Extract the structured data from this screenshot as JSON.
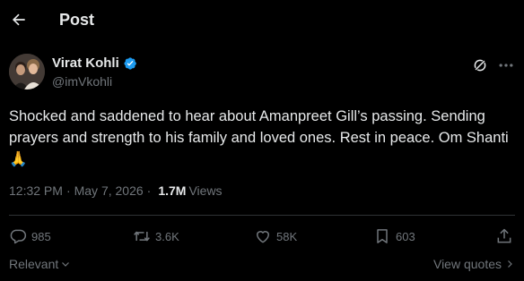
{
  "header": {
    "title": "Post",
    "back_icon": "arrow-left-icon"
  },
  "author": {
    "name": "Virat Kohli",
    "handle": "@imVkohli",
    "verified": true,
    "verified_color": "#1d9bf0"
  },
  "post": {
    "text": "Shocked and saddened to hear about Amanpreet Gill’s passing. Sending prayers and strength to his family and loved ones. Rest in peace. Om Shanti",
    "emoji": "🙏"
  },
  "meta": {
    "time": "12:32 PM",
    "separator": "·",
    "date": "May 7, 2026",
    "views_count": "1.7M",
    "views_label": "Views"
  },
  "actions": {
    "replies": "985",
    "reposts": "3.6K",
    "likes": "58K",
    "bookmarks": "603"
  },
  "footer": {
    "sort_label": "Relevant",
    "view_quotes_label": "View quotes"
  },
  "colors": {
    "background": "#000000",
    "text": "#e7e9ea",
    "muted": "#71767b",
    "divider": "#2f3336"
  }
}
